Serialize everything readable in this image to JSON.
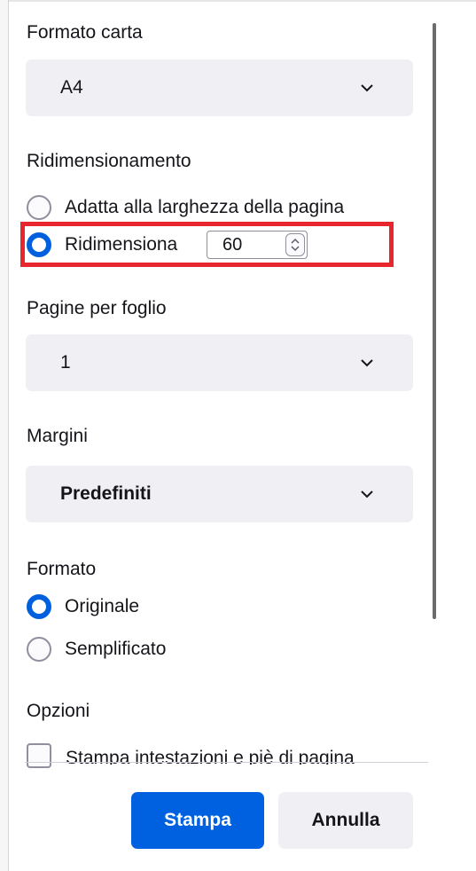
{
  "paper_size": {
    "label": "Formato carta",
    "value": "A4"
  },
  "scaling": {
    "label": "Ridimensionamento",
    "fit_option": "Adatta alla larghezza della pagina",
    "scale_option": "Ridimensiona",
    "scale_value": "60",
    "selected": "scale"
  },
  "pages_per_sheet": {
    "label": "Pagine per foglio",
    "value": "1"
  },
  "margins": {
    "label": "Margini",
    "value": "Predefiniti"
  },
  "format": {
    "label": "Formato",
    "original": "Originale",
    "simplified": "Semplificato",
    "selected": "original"
  },
  "options": {
    "label": "Opzioni",
    "headers_footers": "Stampa intestazioni e piè di pagina",
    "headers_footers_checked": false
  },
  "footer": {
    "print_label": "Stampa",
    "cancel_label": "Annulla"
  },
  "colors": {
    "accent": "#0061e0",
    "highlight": "#e8262d",
    "field_bg": "#f0f0f4"
  },
  "icons": {
    "dropdown": "chevron-down-icon",
    "spin": "spin-arrows-icon"
  }
}
